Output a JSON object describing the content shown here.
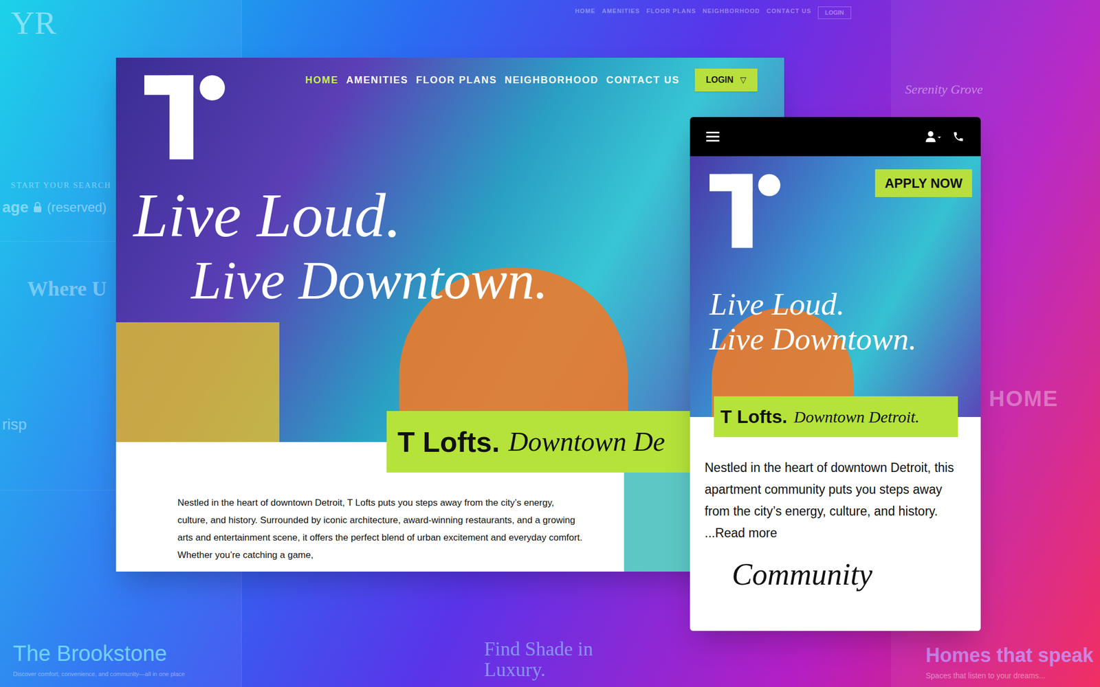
{
  "background": {
    "brand_mark": "YR",
    "search_label": "START YOUR SEARCH",
    "reserved_prefix": "age",
    "reserved_label": "(reserved)",
    "heading_left": "Where U",
    "crisp_label": "risp",
    "nav": [
      "HOME",
      "AMENITIES",
      "FLOOR PLANS",
      "NEIGHBORHOOD",
      "CONTACT US"
    ],
    "login": "LOGIN",
    "serenity": "Serenity Grove",
    "home_label": "HOME",
    "brookstone_title": "The Brookstone",
    "brookstone_sub": "Discover comfort, convenience, and community—all in one place",
    "shade_title": "Find Shade in Luxury.",
    "homes_title": "Homes that speak",
    "homes_sub": "Spaces that listen to your dreams..."
  },
  "desktop": {
    "nav": [
      {
        "label": "HOME",
        "selected": true
      },
      {
        "label": "AMENITIES",
        "selected": false
      },
      {
        "label": "FLOOR PLANS",
        "selected": false
      },
      {
        "label": "NEIGHBORHOOD",
        "selected": false
      },
      {
        "label": "CONTACT US",
        "selected": false
      }
    ],
    "login": "LOGIN",
    "login_caret": "▽",
    "headline": [
      "Live Loud.",
      "Live Downtown."
    ],
    "banner": {
      "name": "T Lofts.",
      "tagline": "Downtown De"
    },
    "intro": "Nestled in the heart of downtown Detroit, T Lofts puts you steps away from the city’s energy, culture, and history. Surrounded by iconic architecture, award-winning restaurants, and a growing arts and entertainment scene, it offers the perfect blend of urban excitement and everyday comfort. Whether you’re catching a game,"
  },
  "mobile": {
    "apply": "APPLY NOW",
    "headline": [
      "Live Loud.",
      "Live Downtown."
    ],
    "banner": {
      "name": "T Lofts.",
      "tagline": "Downtown Detroit."
    },
    "intro": "Nestled in the heart of downtown Detroit, this apartment community puts you steps away from the city’s energy, culture, and history.",
    "read_more": "...Read more",
    "section_title": "Community"
  }
}
